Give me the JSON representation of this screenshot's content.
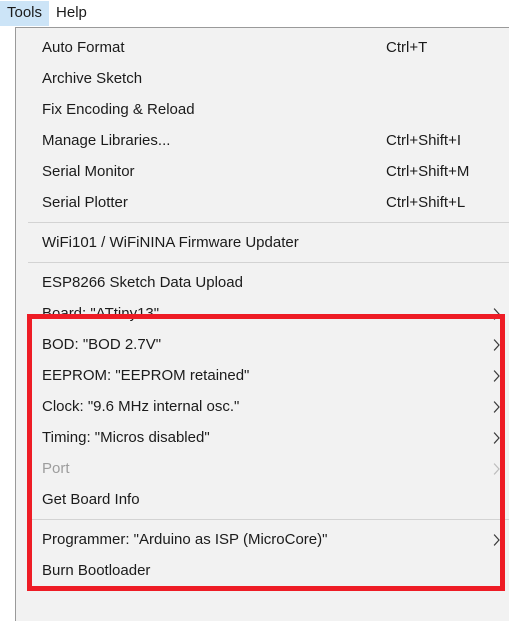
{
  "menubar": {
    "items": [
      {
        "label": "Tools",
        "active": true
      },
      {
        "label": "Help",
        "active": false
      }
    ]
  },
  "dropdown": {
    "owner": "Tools",
    "items": [
      {
        "type": "item",
        "label": "Auto Format",
        "shortcut": "Ctrl+T",
        "submenu": false,
        "disabled": false
      },
      {
        "type": "item",
        "label": "Archive Sketch",
        "shortcut": "",
        "submenu": false,
        "disabled": false
      },
      {
        "type": "item",
        "label": "Fix Encoding & Reload",
        "shortcut": "",
        "submenu": false,
        "disabled": false
      },
      {
        "type": "item",
        "label": "Manage Libraries...",
        "shortcut": "Ctrl+Shift+I",
        "submenu": false,
        "disabled": false
      },
      {
        "type": "item",
        "label": "Serial Monitor",
        "shortcut": "Ctrl+Shift+M",
        "submenu": false,
        "disabled": false
      },
      {
        "type": "item",
        "label": "Serial Plotter",
        "shortcut": "Ctrl+Shift+L",
        "submenu": false,
        "disabled": false
      },
      {
        "type": "separator"
      },
      {
        "type": "item",
        "label": "WiFi101 / WiFiNINA Firmware Updater",
        "shortcut": "",
        "submenu": false,
        "disabled": false
      },
      {
        "type": "separator"
      },
      {
        "type": "item",
        "label": "ESP8266 Sketch Data Upload",
        "shortcut": "",
        "submenu": false,
        "disabled": false
      },
      {
        "type": "item",
        "label": "Board: \"ATtiny13\"",
        "shortcut": "",
        "submenu": true,
        "disabled": false
      },
      {
        "type": "item",
        "label": "BOD: \"BOD 2.7V\"",
        "shortcut": "",
        "submenu": true,
        "disabled": false
      },
      {
        "type": "item",
        "label": "EEPROM: \"EEPROM retained\"",
        "shortcut": "",
        "submenu": true,
        "disabled": false
      },
      {
        "type": "item",
        "label": "Clock: \"9.6 MHz internal osc.\"",
        "shortcut": "",
        "submenu": true,
        "disabled": false
      },
      {
        "type": "item",
        "label": "Timing: \"Micros disabled\"",
        "shortcut": "",
        "submenu": true,
        "disabled": false
      },
      {
        "type": "item",
        "label": "Port",
        "shortcut": "",
        "submenu": true,
        "disabled": true
      },
      {
        "type": "item",
        "label": "Get Board Info",
        "shortcut": "",
        "submenu": false,
        "disabled": false
      },
      {
        "type": "separator"
      },
      {
        "type": "item",
        "label": "Programmer: \"Arduino as ISP (MicroCore)\"",
        "shortcut": "",
        "submenu": true,
        "disabled": false
      },
      {
        "type": "item",
        "label": "Burn Bootloader",
        "shortcut": "",
        "submenu": false,
        "disabled": false
      }
    ]
  },
  "annotation": {
    "highlight_color": "#ee1c25",
    "shape": "rectangle"
  },
  "colors": {
    "menu_background": "#f2f2f2",
    "menubar_highlight": "#cce4f7",
    "text": "#1b1b1b",
    "disabled_text": "#9d9d9d",
    "separator": "#d3d3d3",
    "panel_border": "#9a9a9a"
  }
}
